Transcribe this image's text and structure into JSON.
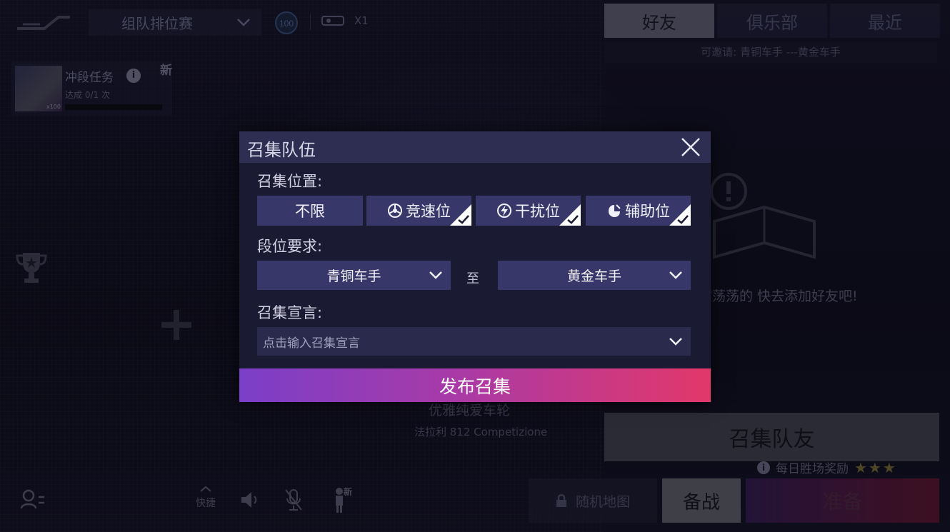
{
  "top_bar": {
    "mode_select": "组队排位赛",
    "rank_badge_number": "100",
    "ticket_count": "X1"
  },
  "task": {
    "title": "冲段任务",
    "new_badge": "新",
    "progress_label": "达成",
    "progress_count": "0/1",
    "progress_unit": "次",
    "progress_value": 0,
    "thumb_tag": "x100"
  },
  "car": {
    "name": "优雅纯爱车轮",
    "model": "法拉利 812 Competizione"
  },
  "right_panel": {
    "tabs": [
      {
        "label": "好友",
        "active": true
      },
      {
        "label": "俱乐部",
        "active": false
      },
      {
        "label": "最近",
        "active": false
      }
    ],
    "invite_range": "可邀请: 青铜车手  ---黄金车手",
    "empty_message": "好友列表空荡荡的 快去添加好友吧!",
    "recruit_button": "召集队友",
    "daily_reward": "每日胜场奖励"
  },
  "bottom_bar": {
    "quick_label": "快捷",
    "person_new": "新",
    "random_map": "随机地图",
    "prepare_button": "备战",
    "ready_button": "准备"
  },
  "modal": {
    "title": "召集队伍",
    "position_label": "召集位置:",
    "positions": [
      {
        "label": "不限",
        "icon": "none",
        "selected": false
      },
      {
        "label": "竞速位",
        "icon": "wheel-icon",
        "selected": true
      },
      {
        "label": "干扰位",
        "icon": "lightning-icon",
        "selected": true
      },
      {
        "label": "辅助位",
        "icon": "support-icon",
        "selected": true
      }
    ],
    "rank_label": "段位要求:",
    "rank_from": "青铜车手",
    "rank_to_word": "至",
    "rank_to": "黄金车手",
    "slogan_label": "召集宣言:",
    "slogan_placeholder": "点击输入召集宣言",
    "publish_button": "发布召集"
  },
  "colors": {
    "modal_bg": "#1b1a33",
    "modal_header": "#2e2d52",
    "option_bg": "#38376a",
    "publish_gradient_start": "#7a3fc8",
    "publish_gradient_end": "#e2386a"
  }
}
